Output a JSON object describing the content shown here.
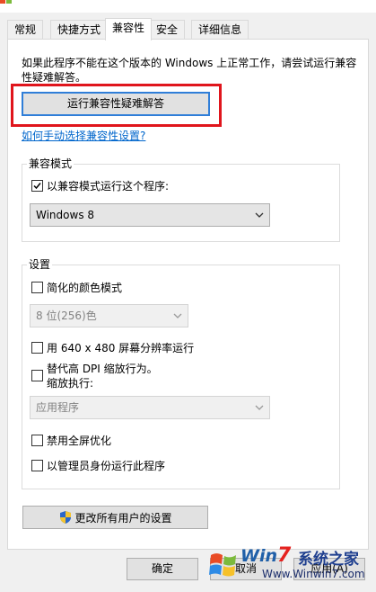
{
  "tabs": [
    {
      "label": "常规"
    },
    {
      "label": "快捷方式"
    },
    {
      "label": "兼容性"
    },
    {
      "label": "安全"
    },
    {
      "label": "详细信息"
    }
  ],
  "active_tab": "兼容性",
  "intro": "如果此程序不能在这个版本的 Windows 上正常工作，请尝试运行兼容性疑难解答。",
  "troubleshooter_button": "运行兼容性疑难解答",
  "manual_link": "如何手动选择兼容性设置?",
  "compat_mode": {
    "group_title": "兼容模式",
    "checkbox_label": "以兼容模式运行这个程序:",
    "checked": true,
    "selected_os": "Windows 8"
  },
  "settings": {
    "group_title": "设置",
    "reduced_color": {
      "label": "简化的颜色模式",
      "checked": false
    },
    "color_select": "8 位(256)色",
    "resolution": {
      "label": "用 640 x 480 屏幕分辨率运行",
      "checked": false
    },
    "dpi": {
      "label_line1": "替代高 DPI 缩放行为。",
      "label_line2": "缩放执行:",
      "checked": false
    },
    "dpi_select": "应用程序",
    "fullscreen_opt": {
      "label": "禁用全屏优化",
      "checked": false
    },
    "run_as_admin": {
      "label": "以管理员身份运行此程序",
      "checked": false
    }
  },
  "change_all_button": "更改所有用户的设置",
  "footer": {
    "ok": "确定",
    "cancel": "取消",
    "apply": "应用(A)"
  },
  "watermark": {
    "brand_win": "Win",
    "brand_seven": "7",
    "brand_cn": "系统之家",
    "url": "Www.Winwin7.com"
  },
  "colors": {
    "highlight_border": "#e0151c",
    "focus_border": "#2f7ed8",
    "link": "#0066cc"
  }
}
